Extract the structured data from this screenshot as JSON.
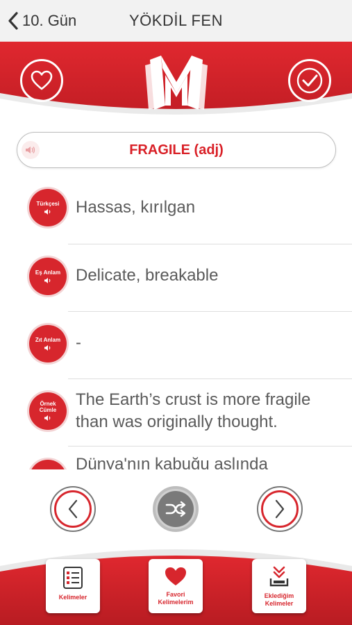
{
  "nav": {
    "back_label": "10. Gün",
    "title": "YÖKDİL FEN"
  },
  "word": {
    "text": "FRAGILE (adj)"
  },
  "entries": [
    {
      "badge": "Türkçesi",
      "text": "Hassas, kırılgan"
    },
    {
      "badge": "Eş Anlam",
      "text": "Delicate, breakable"
    },
    {
      "badge": "Zıt Anlam",
      "text": "-"
    },
    {
      "badge_line1": "Örnek",
      "badge_line2": "Cümle",
      "text": "The Earth’s crust is more fragile than was originally thought."
    },
    {
      "text": "Dünya'nın kabuğu aslında"
    }
  ],
  "tabs": [
    {
      "label": "Kelimeler",
      "icon": "checklist-icon"
    },
    {
      "label_line1": "Favori",
      "label_line2": "Kelimelerim",
      "icon": "heart-icon"
    },
    {
      "label_line1": "Eklediğim",
      "label_line2": "Kelimeler",
      "icon": "download-tray-icon"
    }
  ],
  "colors": {
    "accent": "#d7262d",
    "accent_dark": "#c41e25",
    "text": "#5a5a5a"
  }
}
